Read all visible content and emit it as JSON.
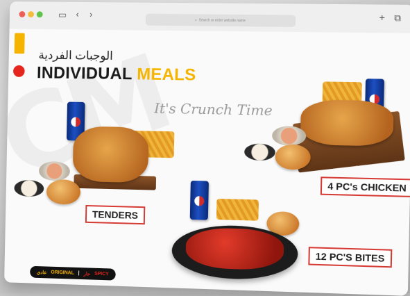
{
  "browser": {
    "address_placeholder": "Search or enter website name",
    "plus_icon": "plus-icon",
    "tabs_icon": "tabs-icon",
    "back_icon": "back-icon",
    "forward_icon": "forward-icon",
    "sidebar_icon": "sidebar-icon"
  },
  "brand": {
    "arabic_title": "الوجبات الفردية",
    "title_part1": "INDIVIDUAL",
    "title_part2": "MEALS",
    "tagline": "It's Crunch Time",
    "accent_yellow": "#f5b400",
    "accent_red": "#e4261e"
  },
  "meals": {
    "tenders_label": "TENDERS",
    "chicken_label": "4 PC's CHICKEN",
    "bites_label": "12 PC'S BITES"
  },
  "flavors": {
    "original": "ORIGINAL",
    "original_ar": "عادي",
    "separator": "|",
    "spicy": "SPICY",
    "spicy_ar": "حار"
  }
}
